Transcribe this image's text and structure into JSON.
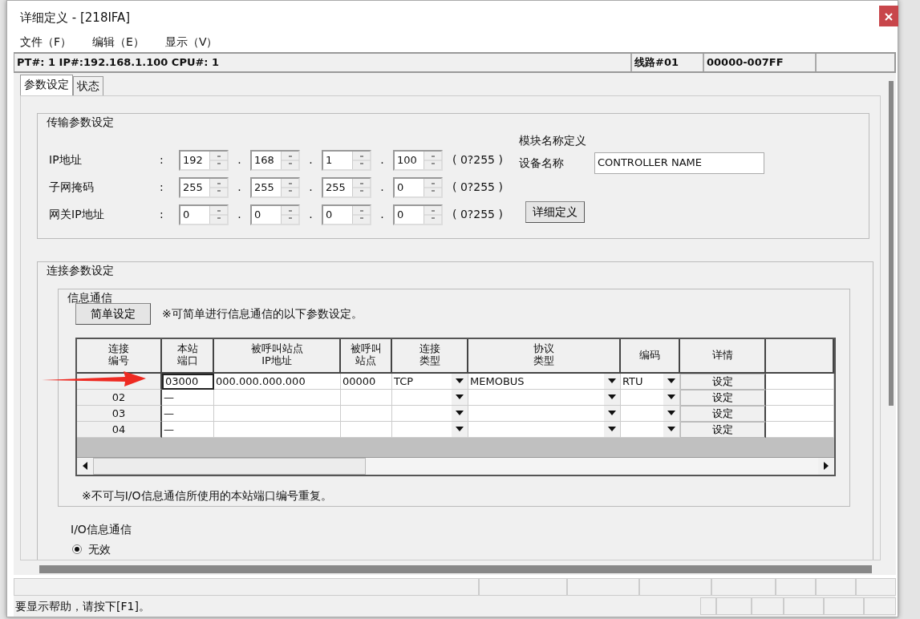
{
  "window": {
    "title": "详细定义 - [218IFA]"
  },
  "menu": [
    {
      "label": "文件（F）"
    },
    {
      "label": "编辑（E）"
    },
    {
      "label": "显示（V）"
    }
  ],
  "info_bar": [
    "PT#: 1 IP#:192.168.1.100 CPU#: 1",
    "线路#01",
    "00000-007FF"
  ],
  "tabs": [
    {
      "label": "参数设定",
      "selected": true
    },
    {
      "label": "状态",
      "selected": false
    }
  ],
  "transmission": {
    "title": "传输参数设定",
    "rows": [
      {
        "label": "IP地址",
        "colon": ":",
        "octets": [
          "192",
          "168",
          "1",
          "100"
        ],
        "separators": [
          ".",
          ".",
          "."
        ],
        "range": "( 0?255 )"
      },
      {
        "label": "子网掩码",
        "colon": ":",
        "octets": [
          "255",
          "255",
          "255",
          "0"
        ],
        "separators": [
          ".",
          ".",
          "."
        ],
        "range": "( 0?255 )"
      },
      {
        "label": "网关IP地址",
        "colon": ":",
        "octets": [
          "0",
          "0",
          "0",
          "0"
        ],
        "separators": [
          ".",
          ".",
          "."
        ],
        "range": "( 0?255 )"
      }
    ],
    "module": {
      "title": "模块名称定义",
      "device_label": "设备名称",
      "device_name": "CONTROLLER NAME",
      "detail_button": "详细定义"
    }
  },
  "connection": {
    "title": "连接参数设定",
    "message": {
      "title": "信息通信",
      "simple_button": "简单设定",
      "hint": "※可简单进行信息通信的以下参数设定。",
      "table": {
        "columns": [
          {
            "lines": [
              "连接",
              "编号"
            ]
          },
          {
            "lines": [
              "本站",
              "端口"
            ]
          },
          {
            "lines": [
              "被呼叫站点",
              "IP地址"
            ]
          },
          {
            "lines": [
              "被呼叫",
              "站点"
            ]
          },
          {
            "lines": [
              "连接",
              "类型"
            ]
          },
          {
            "lines": [
              "协议",
              "类型"
            ]
          },
          {
            "lines": [
              "编码"
            ]
          },
          {
            "lines": [
              "详情"
            ]
          }
        ],
        "rows": [
          {
            "selected": true,
            "port": "03000",
            "ip": "000.000.000.000",
            "remote_port": "00000",
            "connection_type": "TCP",
            "protocol": "MEMOBUS",
            "encoding": "RTU",
            "detail": "设定"
          },
          {
            "selected": false,
            "number": "02",
            "port": "—",
            "detail": "设定"
          },
          {
            "selected": false,
            "number": "03",
            "port": "—",
            "detail": "设定"
          },
          {
            "selected": false,
            "number": "04",
            "port": "—",
            "detail": "设定"
          }
        ]
      },
      "note": "※不可与I/O信息通信所使用的本站端口编号重复。"
    },
    "io": {
      "title": "I/O信息通信",
      "options": [
        {
          "label": "无效",
          "selected": true
        }
      ]
    }
  },
  "status_bar": {
    "help": "要显示帮助，请按下[F1]。"
  }
}
